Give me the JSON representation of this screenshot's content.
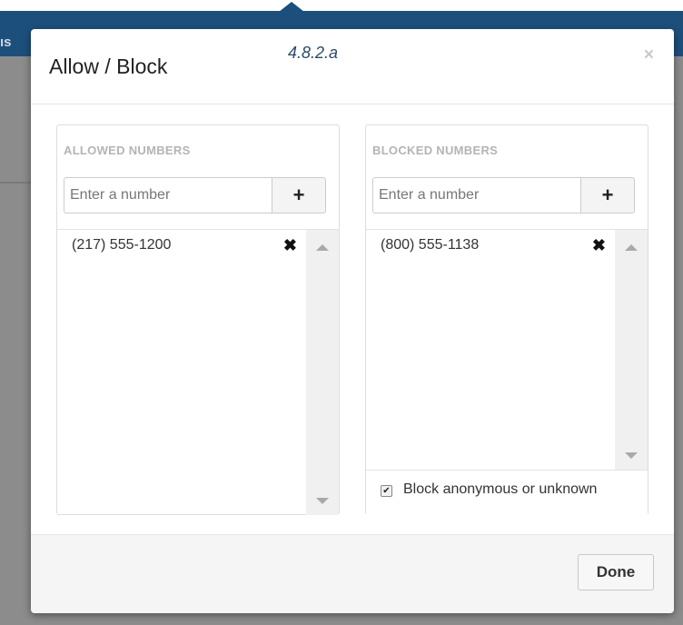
{
  "background": {
    "edge_text": "ıs"
  },
  "dialog": {
    "title": "Allow / Block",
    "version_label": "4.8.2.a",
    "close_icon": "×",
    "done_label": "Done"
  },
  "allowed": {
    "header": "ALLOWED NUMBERS",
    "input_placeholder": "Enter a number",
    "add_icon": "+",
    "items": [
      {
        "number": "(217) 555-1200",
        "remove_icon": "✖"
      }
    ]
  },
  "blocked": {
    "header": "BLOCKED NUMBERS",
    "input_placeholder": "Enter a number",
    "add_icon": "+",
    "items": [
      {
        "number": "(800) 555-1138",
        "remove_icon": "✖"
      }
    ],
    "anonymous_checkbox": {
      "label": "Block anonymous or unknown",
      "checked": true,
      "check_glyph": "✔"
    }
  },
  "colors": {
    "navbar": "#1d4f7c",
    "overlay": "#8c8c8c",
    "version_text": "#2b4a66"
  }
}
